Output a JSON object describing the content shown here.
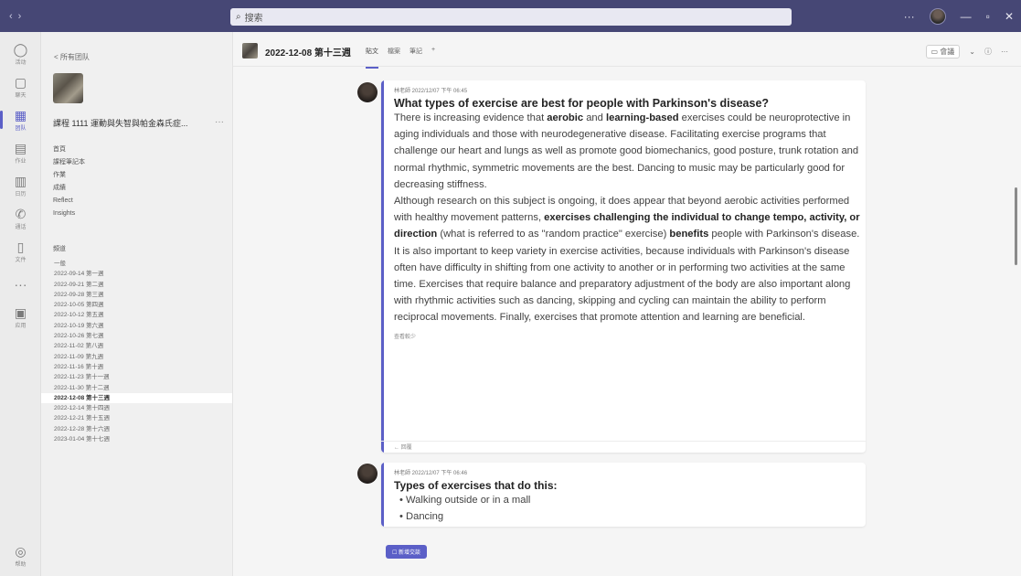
{
  "search": {
    "placeholder": "搜索"
  },
  "rail": [
    {
      "label": "活动",
      "icon": "bell-icon",
      "glyph": "◯"
    },
    {
      "label": "聊天",
      "icon": "chat-icon",
      "glyph": "▢"
    },
    {
      "label": "团队",
      "icon": "teams-icon",
      "glyph": "▦"
    },
    {
      "label": "作业",
      "icon": "assignments-icon",
      "glyph": "▤"
    },
    {
      "label": "日历",
      "icon": "calendar-icon",
      "glyph": "▥"
    },
    {
      "label": "通话",
      "icon": "call-icon",
      "glyph": "✆"
    },
    {
      "label": "文件",
      "icon": "file-icon",
      "glyph": "▯"
    },
    {
      "label": "",
      "icon": "more-icon",
      "glyph": "···"
    },
    {
      "label": "应用",
      "icon": "apps-icon",
      "glyph": "▣"
    },
    {
      "label": "帮助",
      "icon": "help-icon",
      "glyph": "◎"
    }
  ],
  "sidebar": {
    "back_label": "< 所有团队",
    "team_name": "課程 1111 運動與失智與帕金森氏症...",
    "nav": [
      "首頁",
      "課程筆記本",
      "作業",
      "成績",
      "Reflect",
      "Insights"
    ],
    "channels_header": "頻道",
    "channels": [
      "一般",
      "2022-09-14 第一週",
      "2022-09-21 第二週",
      "2022-09-28 第三週",
      "2022-10-05 第四週",
      "2022-10-12 第五週",
      "2022-10-19 第六週",
      "2022-10-26 第七週",
      "2022-11-02 第八週",
      "2022-11-09 第九週",
      "2022-11-16 第十週",
      "2022-11-23 第十一週",
      "2022-11-30 第十二週",
      "2022-12-08 第十三週",
      "2022-12-14 第十四週",
      "2022-12-21 第十五週",
      "2022-12-28 第十六週",
      "2023-01-04 第十七週"
    ],
    "selected_index": 13
  },
  "header": {
    "title": "2022-12-08 第十三週",
    "tabs": [
      "貼文",
      "檔案",
      "筆記",
      "+"
    ],
    "meet_label": "會議",
    "info": "ⓘ",
    "more": "···"
  },
  "post1": {
    "meta": "林老師  2022/12/07 下午 06:45",
    "title": "What types of exercise are best for people with Parkinson's disease?",
    "p1a": "There is increasing evidence that ",
    "p1b": "aerobic",
    "p1c": " and ",
    "p1d": "learning-based",
    "p1e": " exercises could be neuroprotective in aging individuals and those with neurodegenerative disease.  Facilitating exercise programs that challenge our heart and lungs as well as promote good biomechanics, good posture, trunk rotation and normal rhythmic, symmetric movements are the best.  Dancing to music may be particularly good for decreasing stiffness.",
    "p2a": "Although research on this subject is ongoing, it does appear that beyond aerobic activities performed with healthy movement patterns, ",
    "p2b": "exercises challenging the individual to change tempo, activity, or direction",
    "p2c": " (what is referred to as \"random practice\" exercise) ",
    "p2d": "benefits",
    "p2e": " people with Parkinson's disease. It is also important to keep variety in exercise activities, because individuals with Parkinson's disease often have difficulty in shifting from one activity to another or in performing two activities at the same time. Exercises that require balance and preparatory adjustment of the body are also important along with rhythmic activities such as dancing, skipping and cycling can maintain the ability to perform reciprocal movements.   Finally, exercises that promote attention and learning are beneficial.",
    "see_less": "查看較少",
    "reply": "← 回覆"
  },
  "post2": {
    "meta": "林老師  2022/12/07 下午 06:46",
    "title": "Types of exercises that do this:",
    "items": [
      "Walking outside or in a mall",
      "Dancing"
    ]
  },
  "reply_button": "☐ 新增交談"
}
